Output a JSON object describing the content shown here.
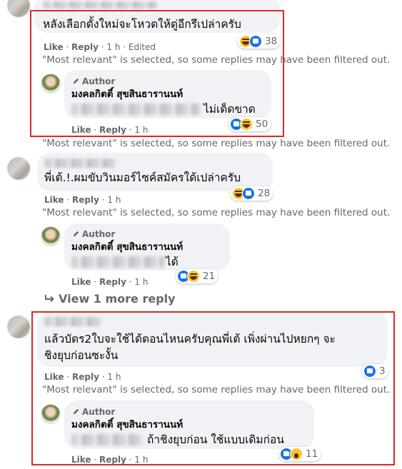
{
  "comments": [
    {
      "text": "หลังเลือกตั้งใหม่จะโหวตให้ตู่อีกรึเปล่าครับ",
      "actions": {
        "like": "Like",
        "reply": "Reply",
        "time": "1 h",
        "edited": "Edited"
      },
      "reaction_count": "38",
      "notice": "\"Most relevant\" is selected, so some replies may have been filtered out.",
      "reply": {
        "badge": "Author",
        "name": "มงคลกิตติ์ สุขสินธารานนท์",
        "text_visible": "ไม่เด็ดขาด",
        "actions": {
          "like": "Like",
          "reply": "Reply",
          "time": "1 h"
        },
        "reaction_count": "50",
        "notice": "\"Most relevant\" is selected, so some replies may have been filtered out."
      }
    },
    {
      "text": "พี่เต้.!.ผมขับวินมอร์ไซค์สมัครใด้เปล่าครับ",
      "actions": {
        "like": "Like",
        "reply": "Reply",
        "time": "1 h"
      },
      "reaction_count": "28",
      "notice": "\"Most relevant\" is selected, so some replies may have been filtered out.",
      "reply": {
        "badge": "Author",
        "name": "มงคลกิตติ์ สุขสินธารานนท์",
        "text_visible": "ได้",
        "actions": {
          "like": "Like",
          "reply": "Reply",
          "time": "1 h"
        },
        "reaction_count": "21"
      },
      "view_more": "View 1 more reply"
    },
    {
      "text_line1": "แล้วบัตร2ใบจะใช้ได้ตอนไหนครับคุณพี่เต้ เพิ่งผ่านไปหยกๆ จะ",
      "text_line2": "ชิงยุบก่อนซะงั้น",
      "actions": {
        "like": "Like",
        "reply": "Reply",
        "time": "1 h"
      },
      "reaction_count": "3",
      "notice": "\"Most relevant\" is selected, so some replies may have been filtered out.",
      "reply": {
        "badge": "Author",
        "name": "มงคลกิตติ์ สุขสินธารานนท์",
        "text_visible": "ถ้าชิงยุบก่อน ใช้แบบเดิมก่อน",
        "actions": {
          "like": "Like",
          "reply": "Reply",
          "time": "1 h"
        },
        "reaction_count": "11"
      }
    }
  ],
  "icons": {
    "like": "like-reaction-icon",
    "haha": "haha-reaction-icon",
    "wow": "wow-reaction-icon",
    "author_badge": "pen-icon",
    "reply_arrow": "reply-arrow-icon"
  },
  "colors": {
    "highlight_box": "#e0262b",
    "like_blue": "#1b74e4",
    "bubble": "#f0f2f5",
    "meta_gray": "#65676b"
  }
}
